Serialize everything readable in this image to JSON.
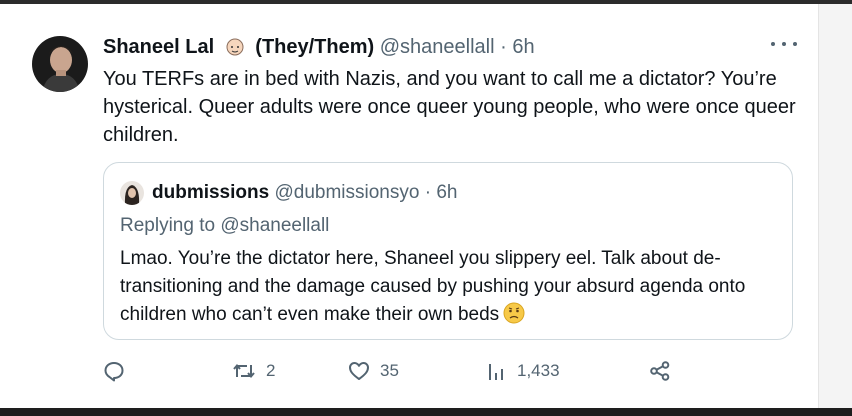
{
  "tweet": {
    "author_name": "Shaneel Lal",
    "pronouns": "(They/Them)",
    "handle": "@shaneellall",
    "time": "· 6h",
    "text": "You TERFs are in bed with Nazis, and you want to call me a dictator? You’re hysterical. Queer adults were once queer young people, who were once queer children.",
    "emoji": "person-emoji-icon"
  },
  "quote": {
    "author_name": "dubmissions",
    "handle": "@dubmissionsyo",
    "time": "· 6h",
    "replying_to": "Replying to @shaneellall",
    "text": "Lmao. You’re the dictator here, Shaneel you slippery eel. Talk about de-transitioning and the damage caused by pushing your absurd agenda onto children who can’t even make their own beds"
  },
  "actions": {
    "replies": "",
    "retweets": "2",
    "likes": "35",
    "views": "1,433"
  },
  "colors": {
    "text": "#0f1419",
    "secondary": "#536471",
    "border": "#cfd9de"
  }
}
